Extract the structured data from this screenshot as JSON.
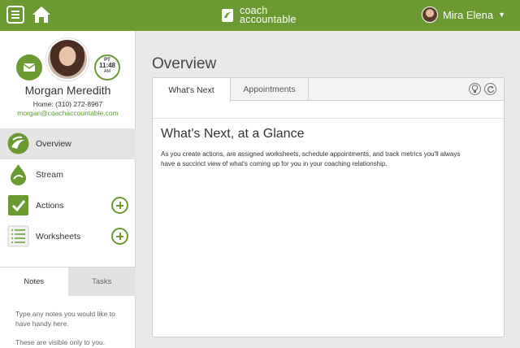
{
  "brand": {
    "line1": "coach",
    "line2": "accountable"
  },
  "user": {
    "name": "Mira Elena"
  },
  "profile": {
    "name": "Morgan Meredith",
    "phone": "Home: (310) 272-8967",
    "email": "morgan@coachaccountable.com",
    "clock": {
      "tz": "PT",
      "time": "11:48",
      "ampm": "AM"
    }
  },
  "nav": {
    "items": [
      {
        "label": "Overview",
        "icon": "overview-icon"
      },
      {
        "label": "Stream",
        "icon": "stream-icon"
      },
      {
        "label": "Actions",
        "icon": "actions-icon"
      },
      {
        "label": "Worksheets",
        "icon": "worksheets-icon"
      }
    ]
  },
  "notes": {
    "tabs": [
      "Notes",
      "Tasks"
    ],
    "placeholder": "Type any notes you would like to have handy here.",
    "visibility": "These are visible only to you."
  },
  "main": {
    "title": "Overview",
    "tabs": [
      "What's Next",
      "Appointments"
    ],
    "content_title": "What's Next, at a Glance",
    "content_body": "As you create actions, are assigned worksheets, schedule appointments, and track metrics you'll always have a succinct view of what's coming up for you in your coaching relationship."
  },
  "colors": {
    "accent": "#6b9a32",
    "link": "#5e9d2d"
  }
}
